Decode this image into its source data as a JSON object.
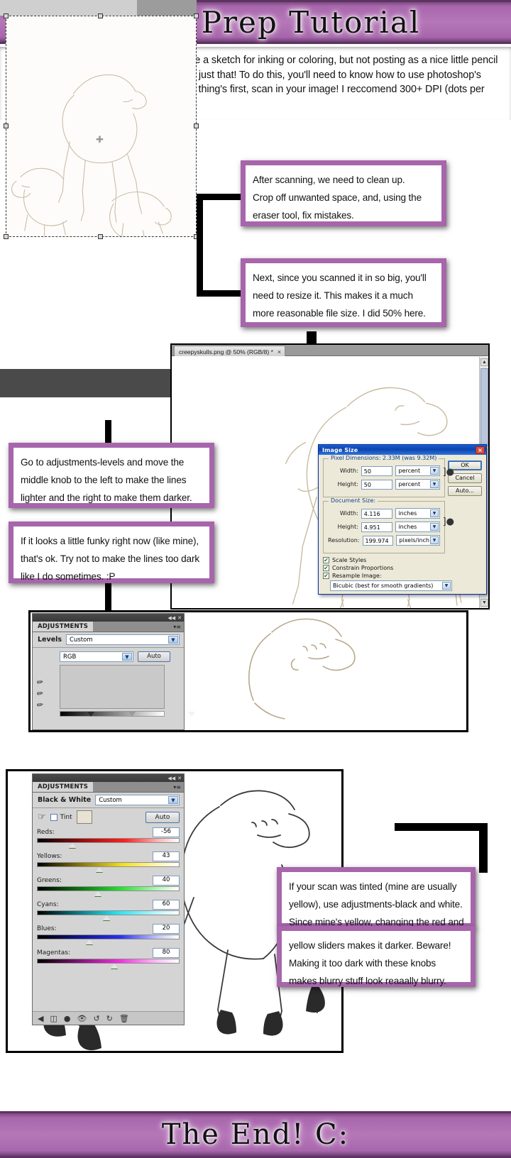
{
  "header": {
    "title": "Pencil Prep Tutorial"
  },
  "footer": {
    "title": "The End!  C:"
  },
  "intro": {
    "text": "I've seen alot of tutorials on how to prepare a sketch for inking or coloring, but not posting as a nice little pencil drawing. So, here's a tutorial on how to do just that!\nTo do this, you'll need to know how to use photoshop's adjustment tools and how to crop. But first thing's first, scan in your image! I reccomend 300+ DPI (dots per inch)."
  },
  "callouts": [
    {
      "id": "clean-up",
      "text": "After scanning, we need to clean up.\nCrop off unwanted space, and, using the eraser tool, fix mistakes."
    },
    {
      "id": "resize",
      "text": "Next, since you scanned it in so big, you'll need to resize it. This makes it a much more reasonable file size. I did 50% here."
    },
    {
      "id": "levels",
      "text": "Go to adjustments-levels and move the middle knob to the left to make the lines lighter and the right to make them darker."
    },
    {
      "id": "funky",
      "text": "If it looks a little funky right now (like mine), that's ok. Try not to make the lines too dark like I do sometimes. :P"
    },
    {
      "id": "black-white",
      "text": "If your scan was tinted (mine are usually yellow), use adjustments-black and white. Since mine's yellow, changing the red and"
    },
    {
      "id": "beware",
      "text": "yellow sliders makes it darker. Beware! Making it too dark with these knobs makes blurry stuff look reaaally blurry."
    }
  ],
  "photoshop_window": {
    "tab_label": "creepyskulls.png @ 50% (RGB/8) *",
    "tab_close": "×",
    "scroll_up": "▲",
    "scroll_down": "▼"
  },
  "image_size_dialog": {
    "title": "Image Size",
    "close": "×",
    "pixel_dimensions_legend": "Pixel Dimensions:  2.33M (was 9.32M)",
    "document_size_legend": "Document Size:",
    "fields": [
      {
        "label": "Width:",
        "value": "50",
        "unit": "percent"
      },
      {
        "label": "Height:",
        "value": "50",
        "unit": "percent"
      }
    ],
    "doc_fields": [
      {
        "label": "Width:",
        "value": "4.116",
        "unit": "inches"
      },
      {
        "label": "Height:",
        "value": "4.951",
        "unit": "inches"
      },
      {
        "label": "Resolution:",
        "value": "199.974",
        "unit": "pixels/inch"
      }
    ],
    "checkboxes": [
      {
        "label": "Scale Styles",
        "checked": true
      },
      {
        "label": "Constrain Proportions",
        "checked": true
      },
      {
        "label": "Resample Image:",
        "checked": true
      }
    ],
    "resample_method": "Bicubic (best for smooth gradients)",
    "buttons": [
      {
        "label": "OK"
      },
      {
        "label": "Cancel"
      },
      {
        "label": "Auto..."
      }
    ],
    "caret": "▼",
    "check_mark": "✔"
  },
  "levels_panel": {
    "panel_tab": "ADJUSTMENTS",
    "collapse_icon": "◀◀",
    "close_icon": "✕",
    "menu_icon": "▾≡",
    "title": "Levels",
    "preset": "Custom",
    "channel": "RGB",
    "auto_label": "Auto",
    "caret": "▼"
  },
  "bw_panel": {
    "panel_tab": "ADJUSTMENTS",
    "collapse_icon": "◀◀",
    "close_icon": "✕",
    "menu_icon": "▾≡",
    "title": "Black & White",
    "preset": "Custom",
    "tint_label": "Tint",
    "auto_label": "Auto",
    "caret": "▼",
    "sliders": [
      {
        "label": "Reds:",
        "value": "-56",
        "knob_pct": 22
      },
      {
        "label": "Yellows:",
        "value": "43",
        "knob_pct": 41
      },
      {
        "label": "Greens:",
        "value": "40",
        "knob_pct": 40
      },
      {
        "label": "Cyans:",
        "value": "60",
        "knob_pct": 46
      },
      {
        "label": "Blues:",
        "value": "20",
        "knob_pct": 34
      },
      {
        "label": "Magentas:",
        "value": "80",
        "knob_pct": 52
      }
    ],
    "footer_icons": [
      "back-arrow-icon",
      "clip-layer-icon",
      "eye-toggle-icon",
      "preview-eye-icon",
      "reset-loop-icon",
      "revert-icon",
      "trash-icon"
    ]
  },
  "colors": {
    "banner_purple": "#b577b8",
    "banner_dark": "#5d3362",
    "callout_border": "#a765ab",
    "dialog_titlebar": "#0b44ad",
    "panel_gray": "#d4d4d4"
  }
}
